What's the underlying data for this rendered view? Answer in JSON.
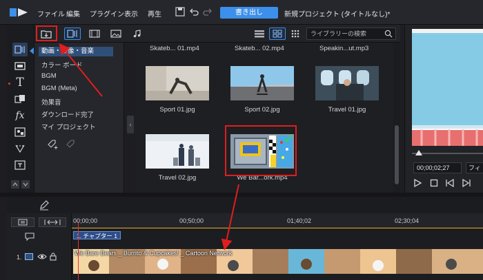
{
  "menubar": {
    "items": [
      "ファイル",
      "編集",
      "プラグイン",
      "表示",
      "再生"
    ],
    "export_label": "書き出し",
    "project_title": "新規プロジェクト (タイトルなし)*"
  },
  "library": {
    "search_placeholder": "ライブラリーの検索",
    "categories": [
      "動画・画像・音楽",
      "カラー ボード",
      "BGM",
      "BGM (Meta)",
      "効果音",
      "ダウンロード完了",
      "マイ プロジェクト"
    ],
    "top_captions": [
      "Skateb... 01.mp4",
      "Skateb... 02.mp4",
      "Speakin...ut.mp3"
    ],
    "tiles": [
      {
        "caption": "Sport 01.jpg"
      },
      {
        "caption": "Sport 02.jpg"
      },
      {
        "caption": "Travel 01.jpg"
      },
      {
        "caption": "Travel 02.jpg"
      },
      {
        "caption": "We Bar...ork.mp4"
      }
    ]
  },
  "preview": {
    "timecode": "00;00;02;27",
    "fit_label": "フィ"
  },
  "timeline": {
    "ruler_labels": [
      "00;00;00",
      "00;50;00",
      "01;40;02",
      "02;30;04"
    ],
    "chapter_label": "1. チャプター 1",
    "track_number": "1.",
    "clip_label": "We Bare Bears _ Burrito & Cupcakes! _ Cartoon Network"
  },
  "colors": {
    "accent": "#3c8fea",
    "highlight": "#e01e1e"
  }
}
